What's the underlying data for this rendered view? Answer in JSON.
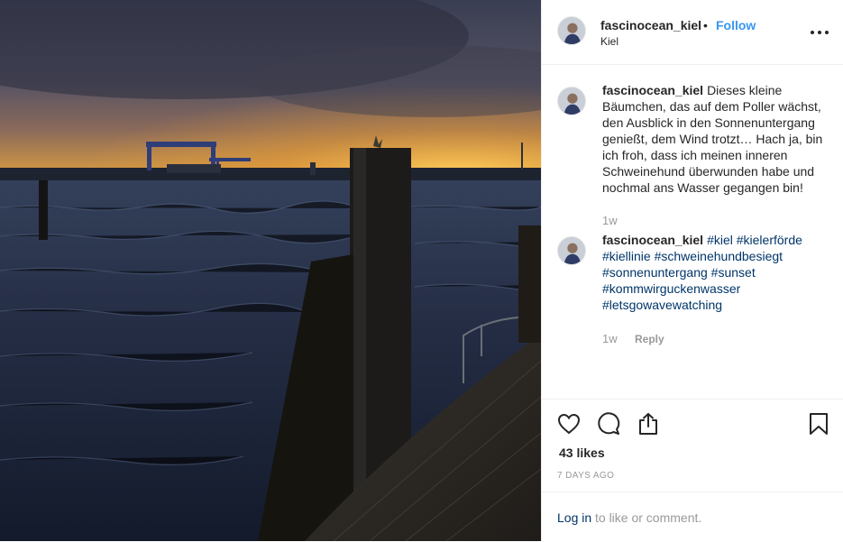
{
  "post": {
    "username": "fascinocean_kiel",
    "separator": "•",
    "follow_label": "Follow",
    "location": "Kiel",
    "more_icon": "more-horizontal-icon",
    "image_alt": "sunset-harbour-photo"
  },
  "comments": [
    {
      "username": "fascinocean_kiel",
      "text": "Dieses kleine Bäumchen, das auf dem Poller wächst, den Ausblick in den Sonnenuntergang genießt, dem Wind trotzt… Hach ja, bin ich froh, dass ich meinen inneren Schweinehund überwunden habe und nochmal ans Wasser gegangen bin!",
      "time": "1w"
    },
    {
      "username": "fascinocean_kiel",
      "hashtags": [
        "#kiel",
        "#kielerförde",
        "#kiellinie",
        "#schweinehundbesiegt",
        "#sonnenuntergang",
        "#sunset",
        "#kommwirguckenwasser",
        "#letsgowavewatching"
      ],
      "time": "1w",
      "reply_label": "Reply"
    }
  ],
  "actions": {
    "like_icon": "heart-icon",
    "comment_icon": "comment-icon",
    "share_icon": "share-icon",
    "save_icon": "bookmark-icon",
    "likes_text": "43 likes",
    "likes_count": 43,
    "time_ago": "7 DAYS AGO"
  },
  "login": {
    "link_label": "Log in",
    "rest_text": "to like or comment."
  },
  "colors": {
    "link_blue": "#3897f0",
    "hashtag_blue": "#003569",
    "muted_gray": "#999999",
    "text_dark": "#262626"
  }
}
